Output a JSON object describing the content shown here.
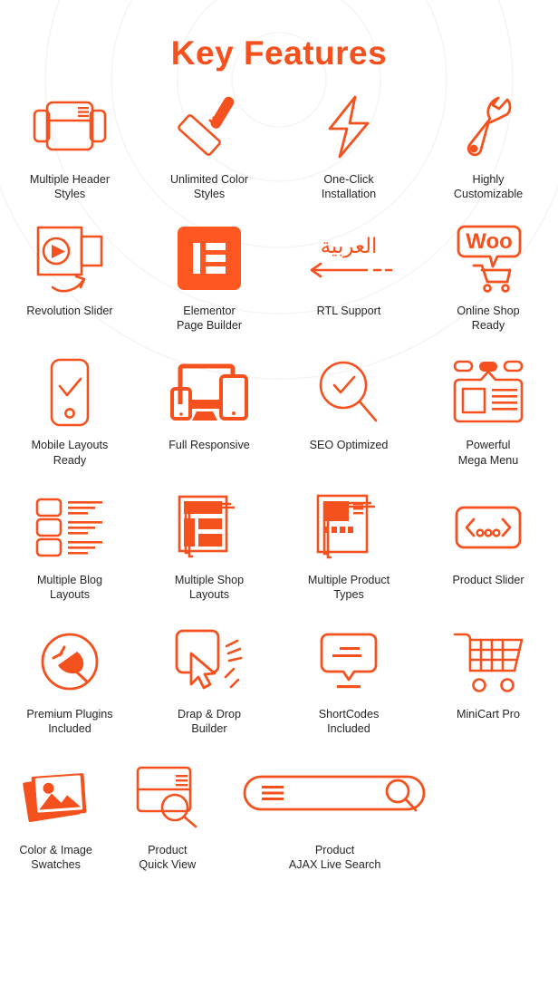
{
  "theme": {
    "accent": "#f4511e",
    "accent_alt": "#ff5722",
    "label_color": "#262626",
    "background": "#ffffff",
    "ring_color": "#f7f5f4"
  },
  "header": {
    "title": "Key Features"
  },
  "features": {
    "rows": [
      {
        "items": [
          {
            "icon": "multiple-header-styles-icon",
            "label": "Multiple Header\nStyles"
          },
          {
            "icon": "paint-roller-icon",
            "label": "Unlimited Color\nStyles"
          },
          {
            "icon": "lightning-bolt-icon",
            "label": "One-Click\nInstallation"
          },
          {
            "icon": "wrench-icon",
            "label": "Highly\nCustomizable"
          }
        ]
      },
      {
        "items": [
          {
            "icon": "revolution-slider-icon",
            "label": "Revolution Slider"
          },
          {
            "icon": "elementor-logo-icon",
            "label": "Elementor\nPage Builder"
          },
          {
            "icon": "rtl-arabic-arrow-icon",
            "label": "RTL Support",
            "arabic_text": "العربية"
          },
          {
            "icon": "woocommerce-cart-icon",
            "label": "Online Shop\nReady",
            "woo_text": "Woo"
          }
        ]
      },
      {
        "items": [
          {
            "icon": "mobile-check-icon",
            "label": "Mobile Layouts\nReady"
          },
          {
            "icon": "responsive-devices-icon",
            "label": "Full Responsive"
          },
          {
            "icon": "seo-magnifier-check-icon",
            "label": "SEO Optimized"
          },
          {
            "icon": "mega-menu-icon",
            "label": "Powerful\nMega Menu"
          }
        ]
      },
      {
        "items": [
          {
            "icon": "blog-list-layout-icon",
            "label": "Multiple Blog\nLayouts"
          },
          {
            "icon": "shop-grid-layout-icon",
            "label": "Multiple Shop\nLayouts"
          },
          {
            "icon": "product-types-icon",
            "label": "Multiple Product\nTypes"
          },
          {
            "icon": "product-slider-icon",
            "label": "Product Slider"
          }
        ]
      },
      {
        "items": [
          {
            "icon": "plugin-plug-icon",
            "label": "Premium Plugins\nIncluded"
          },
          {
            "icon": "drag-drop-cursor-icon",
            "label": "Drap & Drop\nBuilder"
          },
          {
            "icon": "shortcode-bubble-icon",
            "label": "ShortCodes\nIncluded"
          },
          {
            "icon": "minicart-trolley-icon",
            "label": "MiniCart Pro"
          }
        ]
      },
      {
        "items": [
          {
            "icon": "photo-stack-icon",
            "label": "Color & Image\nSwatches"
          },
          {
            "icon": "quick-view-card-icon",
            "label": "Product\nQuick View"
          },
          {
            "icon": "ajax-search-bar-icon",
            "label": "Product\nAJAX Live Search"
          }
        ]
      }
    ]
  }
}
